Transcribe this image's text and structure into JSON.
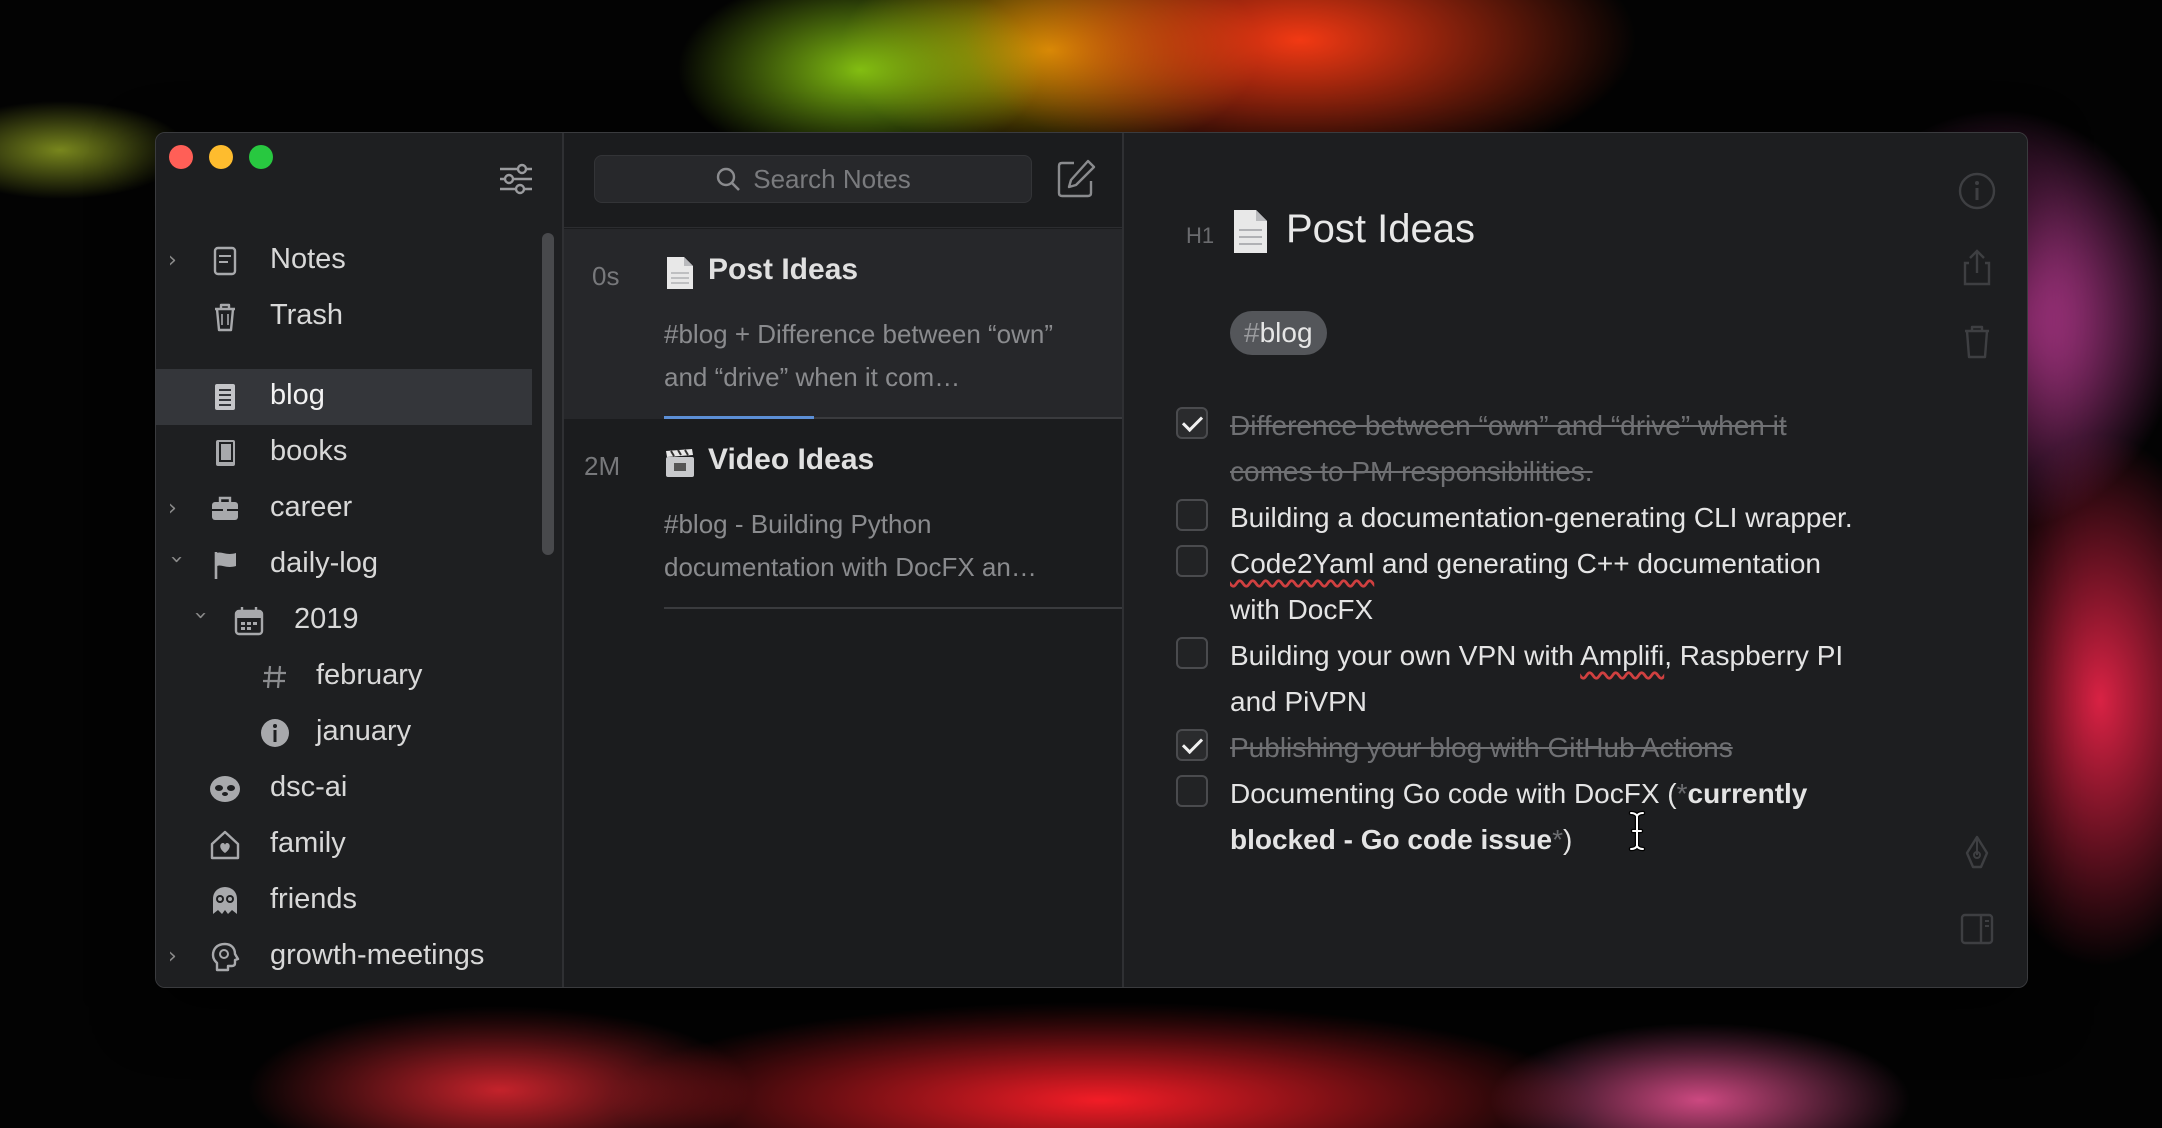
{
  "sidebar": {
    "items": [
      {
        "label": "Notes",
        "icon": "note-icon",
        "chevron": ">"
      },
      {
        "label": "Trash",
        "icon": "trash-icon",
        "chevron": ""
      },
      {
        "label": "blog",
        "icon": "notebook-icon",
        "chevron": "",
        "active": true
      },
      {
        "label": "books",
        "icon": "book-icon",
        "chevron": ""
      },
      {
        "label": "career",
        "icon": "briefcase-icon",
        "chevron": ">"
      },
      {
        "label": "daily-log",
        "icon": "flag-icon",
        "chevron": "v"
      },
      {
        "label": "2019",
        "icon": "calendar-icon",
        "chevron": "v"
      },
      {
        "label": "february",
        "icon": "hashtag-icon",
        "chevron": ""
      },
      {
        "label": "january",
        "icon": "info-icon",
        "chevron": ""
      },
      {
        "label": "dsc-ai",
        "icon": "sloth-icon",
        "chevron": ""
      },
      {
        "label": "family",
        "icon": "home-heart-icon",
        "chevron": ""
      },
      {
        "label": "friends",
        "icon": "ghost-icon",
        "chevron": ""
      },
      {
        "label": "growth-meetings",
        "icon": "brain-icon",
        "chevron": ">"
      }
    ]
  },
  "search": {
    "placeholder": "Search Notes"
  },
  "notes": [
    {
      "age": "0s",
      "title": "Post Ideas",
      "icon": "page-icon",
      "snippet": "#blog + Difference between “own” and “drive” when it com…"
    },
    {
      "age": "2M",
      "title": "Video Ideas",
      "icon": "clapperboard-icon",
      "snippet": "#blog - Building Python documentation with DocFX an…"
    }
  ],
  "editor": {
    "heading_marker": "H1",
    "title": "Post Ideas",
    "tag_hash": "#",
    "tag_name": "blog",
    "todos": [
      {
        "checked": true,
        "text": "Difference between “own” and “drive” when it comes to PM responsibilities."
      },
      {
        "checked": false,
        "text": "Building a documentation-generating CLI wrapper."
      },
      {
        "checked": false,
        "text_a": "Code2Yaml",
        "text_b": " and generating C++ documentation with DocFX"
      },
      {
        "checked": false,
        "text_a": "Building your own VPN with ",
        "text_b": "Amplifi",
        "text_c": ", Raspberry PI and PiVPN"
      },
      {
        "checked": true,
        "text": "Publishing your blog with GitHub Actions"
      },
      {
        "checked": false,
        "text_a": "Documenting Go code with DocFX (",
        "star": "*",
        "bold": "currently blocked - Go code issue",
        "star2": "*",
        "text_c": ")"
      }
    ]
  },
  "colors": {
    "accent_progress": "#5c8fd6",
    "traffic_red": "#ff5f57",
    "traffic_yellow": "#febc2e",
    "traffic_green": "#28c840"
  }
}
